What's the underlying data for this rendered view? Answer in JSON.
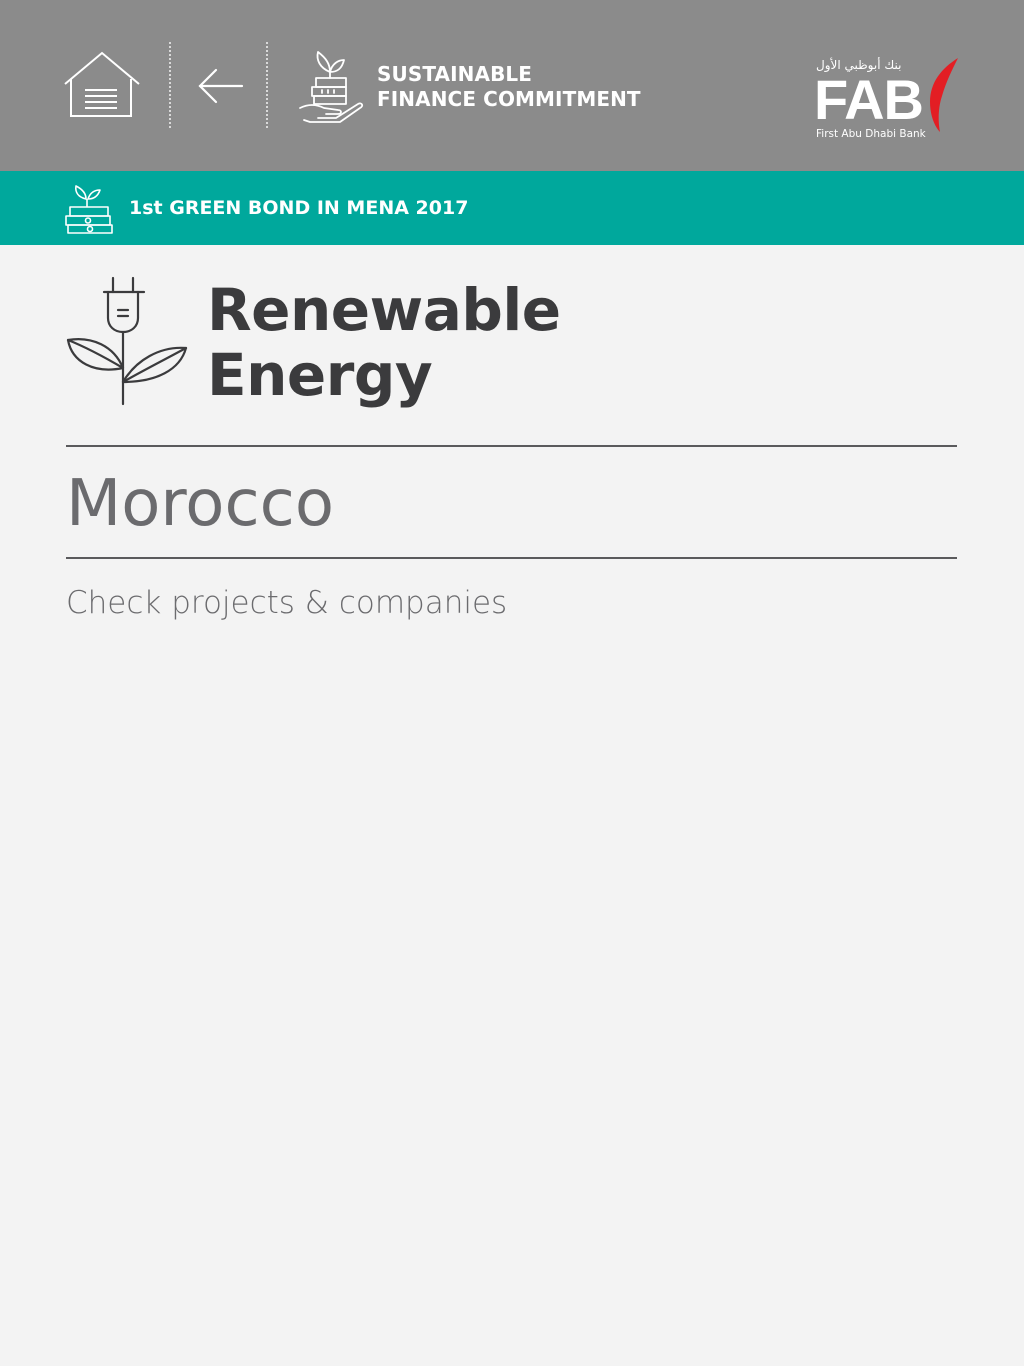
{
  "header": {
    "background_color": "#8b8b8b",
    "home_icon": "home-icon",
    "back_icon": "arrow-left-icon",
    "commitment_icon": "hand-plant-money-icon",
    "commitment_title": [
      "SUSTAINABLE",
      "FINANCE COMMITMENT"
    ],
    "logo": {
      "arabic": "بنك أبوظبي الأول",
      "mark": "FAB",
      "name": "First Abu Dhabi Bank",
      "accent_color": "#e31e24"
    }
  },
  "banner": {
    "background_color": "#00a89c",
    "icon": "money-plant-icon",
    "label": "1st GREEN BOND IN MENA 2017"
  },
  "sector": {
    "icon": "plug-plant-icon",
    "title": [
      "Renewable",
      "Energy"
    ]
  },
  "country": "Morocco",
  "projects_link": "Check projects & companies"
}
